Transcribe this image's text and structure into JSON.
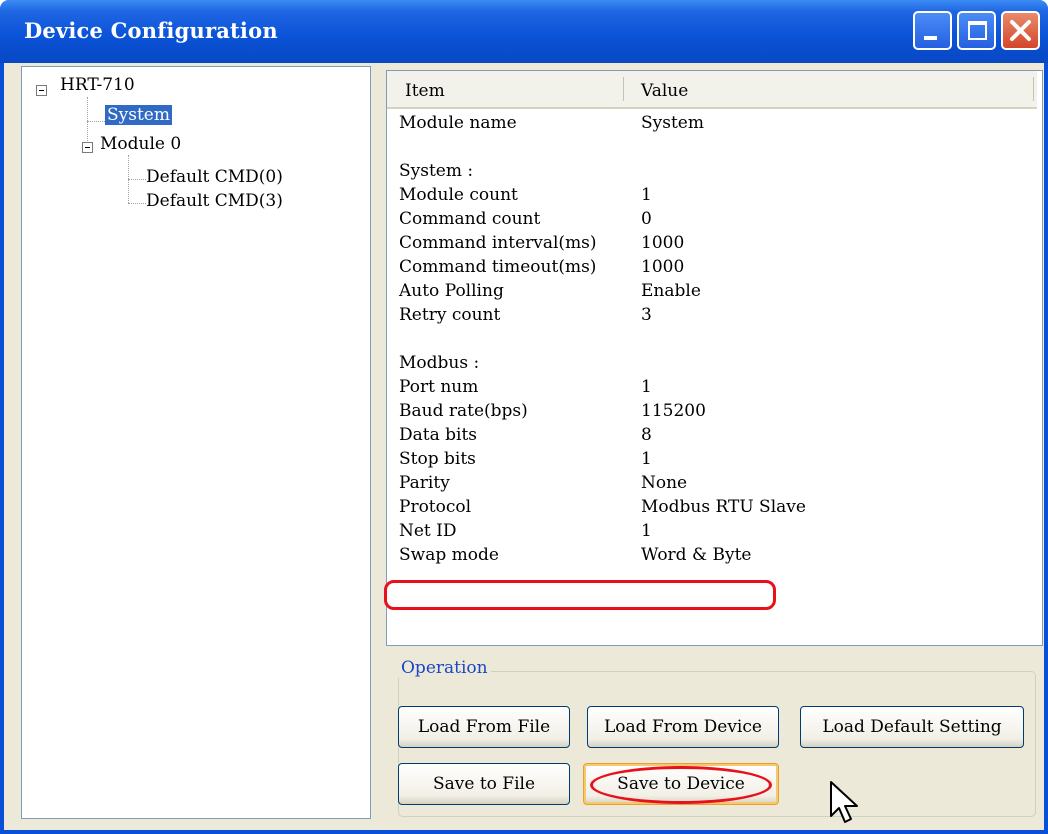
{
  "window": {
    "title": "Device Configuration"
  },
  "tree": {
    "root": "HRT-710",
    "system": "System",
    "module": "Module 0",
    "children": [
      "Default CMD(0)",
      "Default CMD(3)"
    ]
  },
  "list": {
    "header": {
      "item": "Item",
      "value": "Value"
    },
    "rows": [
      {
        "k": "Module name",
        "v": "System"
      },
      {
        "k": "",
        "v": ""
      },
      {
        "k": "System :",
        "v": ""
      },
      {
        "k": "Module count",
        "v": "1"
      },
      {
        "k": "Command count",
        "v": "0"
      },
      {
        "k": "Command interval(ms)",
        "v": "1000"
      },
      {
        "k": "Command timeout(ms)",
        "v": "1000"
      },
      {
        "k": "Auto Polling",
        "v": "Enable"
      },
      {
        "k": "Retry count",
        "v": "3"
      },
      {
        "k": "",
        "v": ""
      },
      {
        "k": "Modbus :",
        "v": ""
      },
      {
        "k": "Port num",
        "v": "1"
      },
      {
        "k": "Baud rate(bps)",
        "v": "115200"
      },
      {
        "k": "Data bits",
        "v": "8"
      },
      {
        "k": "Stop bits",
        "v": "1"
      },
      {
        "k": "Parity",
        "v": "None"
      },
      {
        "k": "Protocol",
        "v": "Modbus RTU Slave"
      },
      {
        "k": "Net ID",
        "v": "1"
      },
      {
        "k": "Swap mode",
        "v": "Word & Byte"
      }
    ]
  },
  "operation": {
    "label": "Operation",
    "load_from_file": "Load From File",
    "load_from_device": "Load From Device",
    "load_default": "Load Default Setting",
    "save_to_file": "Save to File",
    "save_to_device": "Save to Device"
  },
  "colors": {
    "titlebar": "#0a52d6",
    "highlight": "#e8101a",
    "selection": "#316ac5"
  }
}
